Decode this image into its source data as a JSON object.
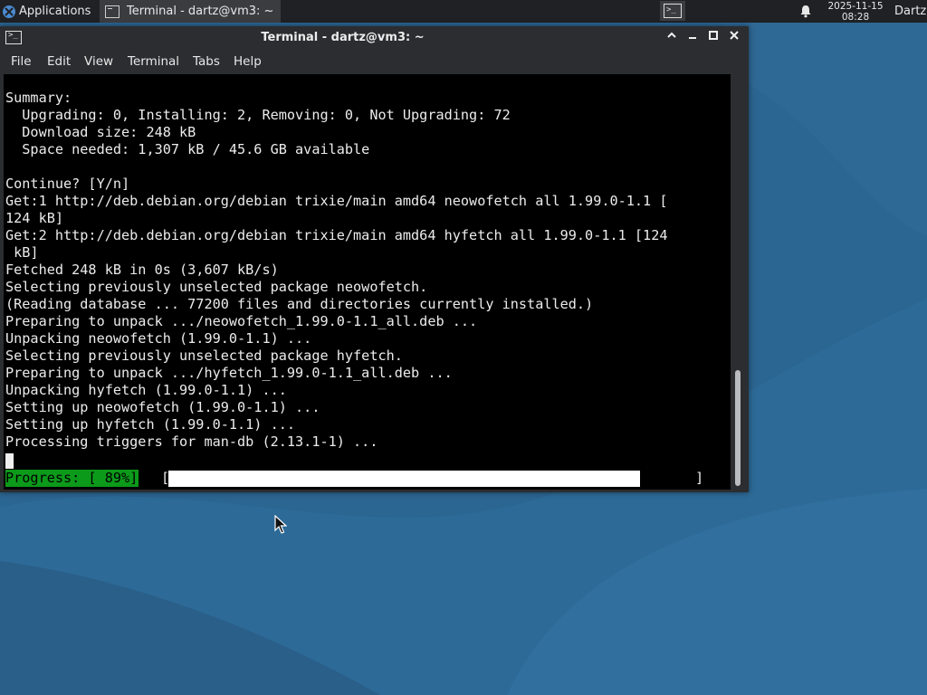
{
  "panel": {
    "applications_label": "Applications",
    "task_label": "Terminal - dartz@vm3: ~",
    "clock_date": "2025-11-15",
    "clock_time": "08:28",
    "user_label": "Dartz"
  },
  "window": {
    "title": "Terminal - dartz@vm3: ~",
    "menu": [
      "File",
      "Edit",
      "View",
      "Terminal",
      "Tabs",
      "Help"
    ]
  },
  "terminal": {
    "lines": [
      "Summary:",
      "  Upgrading: 0, Installing: 2, Removing: 0, Not Upgrading: 72",
      "  Download size: 248 kB",
      "  Space needed: 1,307 kB / 45.6 GB available",
      "",
      "Continue? [Y/n]",
      "Get:1 http://deb.debian.org/debian trixie/main amd64 neowofetch all 1.99.0-1.1 [",
      "124 kB]",
      "Get:2 http://deb.debian.org/debian trixie/main amd64 hyfetch all 1.99.0-1.1 [124",
      " kB]",
      "Fetched 248 kB in 0s (3,607 kB/s)",
      "Selecting previously unselected package neowofetch.",
      "(Reading database ... 77200 files and directories currently installed.)",
      "Preparing to unpack .../neowofetch_1.99.0-1.1_all.deb ...",
      "Unpacking neowofetch (1.99.0-1.1) ...",
      "Selecting previously unselected package hyfetch.",
      "Preparing to unpack .../hyfetch_1.99.0-1.1_all.deb ...",
      "Unpacking hyfetch (1.99.0-1.1) ...",
      "Setting up neowofetch (1.99.0-1.1) ...",
      "Setting up hyfetch (1.99.0-1.1) ...",
      "Processing triggers for man-db (2.13.1-1) ..."
    ],
    "progress_label": "Progress: [ 89%]",
    "progress_fraction": 0.89,
    "bracket_open": "[",
    "bracket_close": "]"
  },
  "colors": {
    "panel_bg": "#1f2124",
    "window_bg": "#2b2d30",
    "terminal_bg": "#000000",
    "terminal_fg": "#ececec",
    "progress_green": "#0c9a1a",
    "wallpaper_base": "#2a5f88"
  },
  "icons": {
    "applications": "xfce-logo-icon",
    "terminal": "terminal-icon",
    "notifications": "bell-icon",
    "minimize": "minimize-icon",
    "maximize": "maximize-icon",
    "close": "close-icon",
    "shade": "chevron-up-icon"
  }
}
